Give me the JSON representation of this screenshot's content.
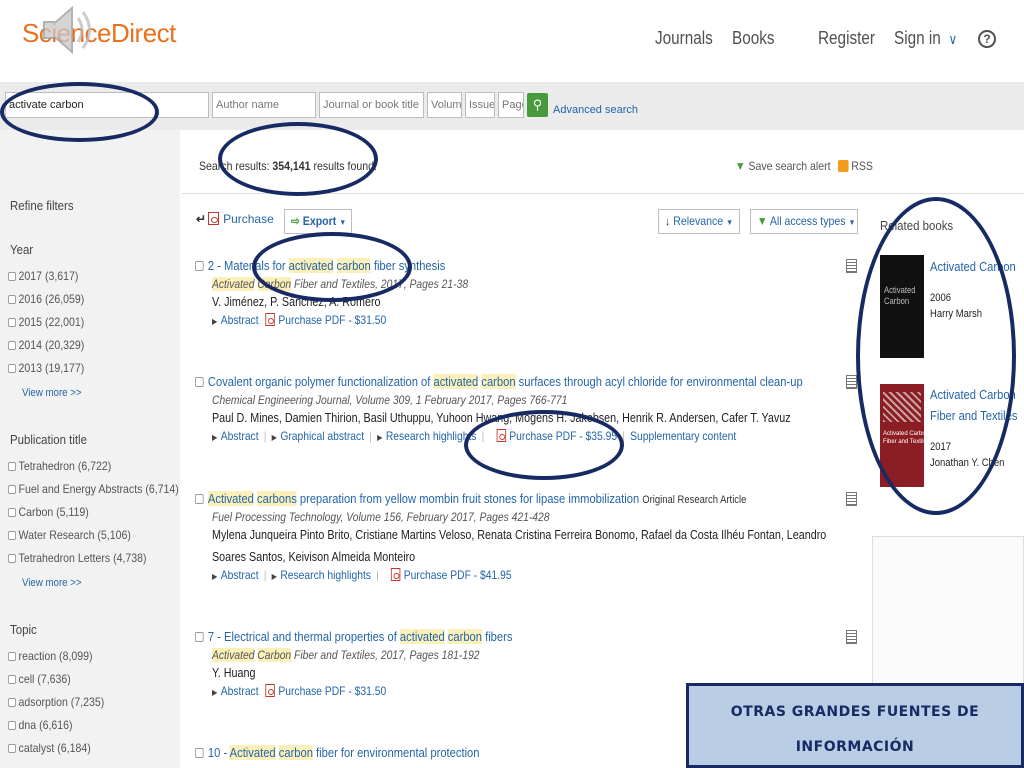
{
  "header": {
    "logo": "ScienceDirect",
    "nav": {
      "journals": "Journals",
      "books": "Books",
      "register": "Register",
      "sign_in": "Sign in"
    },
    "help_icon": "?"
  },
  "search": {
    "keywords_value": "activate carbon",
    "author_placeholder": "Author name",
    "journal_placeholder": "Journal or book title",
    "volume_placeholder": "Volume",
    "issue_placeholder": "Issue",
    "page_placeholder": "Page",
    "advanced_label": "Advanced search"
  },
  "results_info": {
    "prefix": "Search results: ",
    "count": "354,141",
    "suffix": " results found."
  },
  "actions": {
    "save_alert": "Save search alert",
    "rss": "RSS",
    "purchase": "Purchase",
    "export": "Export",
    "relevance": "Relevance",
    "access": "All access types"
  },
  "filters": {
    "title": "Refine filters",
    "groups": [
      {
        "title": "Year",
        "items": [
          "2017 (3,617)",
          "2016 (26,059)",
          "2015 (22,001)",
          "2014 (20,329)",
          "2013 (19,177)"
        ],
        "more": "View more >>"
      },
      {
        "title": "Publication title",
        "items": [
          "Tetrahedron (6,722)",
          "Fuel and Energy Abstracts (6,714)",
          "Carbon (5,119)",
          "Water Research (5,106)",
          "Tetrahedron Letters (4,738)"
        ],
        "more": "View more >>"
      },
      {
        "title": "Topic",
        "items": [
          "reaction (8,099)",
          "cell (7,636)",
          "adsorption (7,235)",
          "dna (6,616)",
          "catalyst (6,184)"
        ]
      }
    ]
  },
  "results": [
    {
      "title_parts": [
        "2 - Materials for ",
        "activated",
        " ",
        "carbon",
        " fiber synthesis"
      ],
      "source_parts": [
        "Activated",
        " ",
        "Carbon",
        " Fiber and Textiles, 2017, Pages 21-38"
      ],
      "authors": "V. Jiménez, P. Sánchez, A. Romero",
      "links": {
        "abstract": "Abstract",
        "pdf": "Purchase PDF - $31.50"
      }
    },
    {
      "title_parts": [
        "Covalent organic polymer functionalization of ",
        "activated",
        " ",
        "carbon",
        " surfaces through acyl chloride for environmental clean-up"
      ],
      "source": "Chemical Engineering Journal, Volume 309, 1 February 2017, Pages 766-771",
      "authors": "Paul D. Mines, Damien Thirion, Basil Uthuppu, Yuhoon Hwang, Mogens H. Jakobsen, Henrik R. Andersen, Cafer T. Yavuz",
      "links": {
        "abstract": "Abstract",
        "graphical": "Graphical abstract",
        "highlights": "Research highlights",
        "pdf": "Purchase PDF - $35.95",
        "supplementary": "Supplementary content"
      }
    },
    {
      "title_parts": [
        "Activated",
        " ",
        "carbons",
        " preparation from yellow mombin fruit stones for lipase immobilization"
      ],
      "article_type": "Original Research Article",
      "source": "Fuel Processing Technology, Volume 156, February 2017, Pages 421-428",
      "authors": "Mylena Junqueira Pinto Brito, Cristiane Martins Veloso, Renata Cristina Ferreira Bonomo, Rafael da Costa Ilhéu Fontan, Leandro Soares Santos, Keivison Almeida Monteiro",
      "links": {
        "abstract": "Abstract",
        "highlights": "Research highlights",
        "pdf": "Purchase PDF - $41.95"
      }
    },
    {
      "title_parts": [
        "7 - Electrical and thermal properties of ",
        "activated",
        " ",
        "carbon",
        " fibers"
      ],
      "source_parts": [
        "Activated",
        " ",
        "Carbon",
        " Fiber and Textiles, 2017, Pages 181-192"
      ],
      "authors": "Y. Huang",
      "links": {
        "abstract": "Abstract",
        "pdf": "Purchase PDF - $31.50"
      }
    },
    {
      "title_parts": [
        "10 - ",
        "Activated",
        " ",
        "carbon",
        " fiber for environmental protection"
      ]
    }
  ],
  "related": {
    "title": "Related books",
    "books": [
      {
        "title": "Activated Carbon",
        "year": "2006",
        "author": "Harry Marsh",
        "cover_text": [
          "Activated",
          "Carbon"
        ]
      },
      {
        "title_lines": [
          "Activated Carbon",
          "Fiber and Textiles"
        ],
        "year": "2017",
        "author": "Jonathan Y. Chen",
        "cover_text": [
          "Activated Carbon",
          "Fiber and Textiles"
        ]
      }
    ]
  },
  "banner": {
    "line1": "OTRAS GRANDES FUENTES DE",
    "line2": "INFORMACIÓN"
  },
  "colors": {
    "link": "#2465a8",
    "logo": "#e9711c",
    "highlight": "#fbf0ba",
    "annotation": "#172a63",
    "banner_bg": "#b9cde4"
  }
}
